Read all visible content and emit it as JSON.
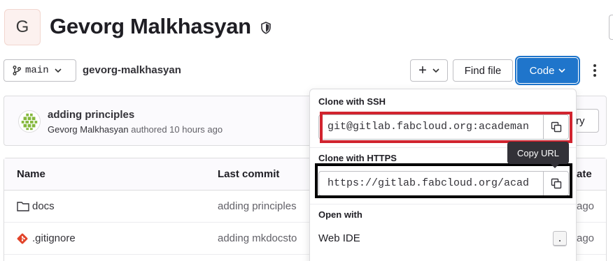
{
  "project": {
    "avatar_letter": "G",
    "title": "Gevorg Malkhasyan",
    "visibility_icon": "shield-icon"
  },
  "toolbar": {
    "branch": "main",
    "path": "gevorg-malkhasyan",
    "add_label": "+",
    "find_file_label": "Find file",
    "code_label": "Code"
  },
  "last_commit": {
    "title": "adding principles",
    "author": "Gevorg Malkhasyan",
    "meta": "authored 10 hours ago",
    "history_label": "ry"
  },
  "files": {
    "headers": {
      "name": "Name",
      "last_commit": "Last commit",
      "update": "ate"
    },
    "rows": [
      {
        "name": "docs",
        "icon": "folder-icon",
        "commit": "adding principles",
        "time": "ago"
      },
      {
        "name": ".gitignore",
        "icon": "git-file-icon",
        "commit": "adding mkdocsto",
        "time": "ago"
      }
    ]
  },
  "clone_dropdown": {
    "ssh_label": "Clone with SSH",
    "ssh_url": "git@gitlab.fabcloud.org:academan",
    "https_label": "Clone with HTTPS",
    "https_url": "https://gitlab.fabcloud.org/acad",
    "open_with_label": "Open with",
    "web_ide_label": "Web IDE",
    "web_ide_shortcut": "."
  },
  "tooltip": {
    "copy_url": "Copy URL"
  },
  "colors": {
    "primary": "#1f75cb",
    "ssh_highlight": "#d1242f",
    "https_highlight": "#000000",
    "avatar_bg": "#fcf1ef",
    "gitignore_icon": "#e24329"
  }
}
